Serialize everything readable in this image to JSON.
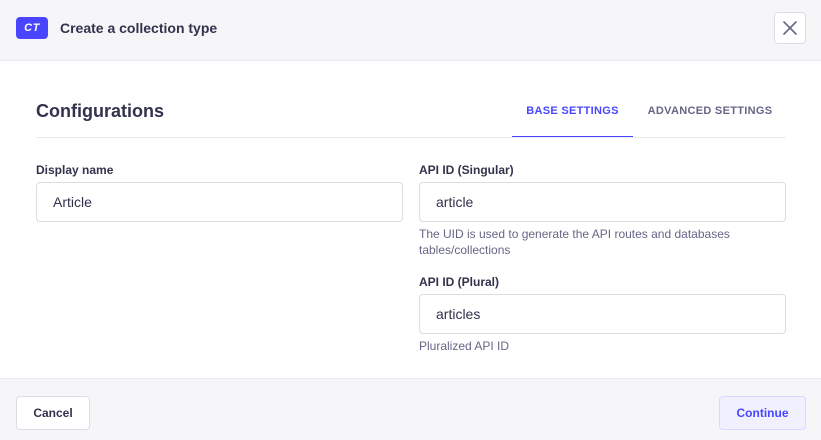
{
  "header": {
    "badge": "CT",
    "title": "Create a collection type",
    "close_icon": "close-icon"
  },
  "section": {
    "title": "Configurations"
  },
  "tabs": [
    {
      "label": "BASE SETTINGS",
      "active": true
    },
    {
      "label": "ADVANCED SETTINGS",
      "active": false
    }
  ],
  "form": {
    "display_name": {
      "label": "Display name",
      "value": "Article"
    },
    "api_singular": {
      "label": "API ID (Singular)",
      "value": "article",
      "hint": "The UID is used to generate the API routes and databases tables/collections"
    },
    "api_plural": {
      "label": "API ID (Plural)",
      "value": "articles",
      "hint": "Pluralized API ID"
    }
  },
  "footer": {
    "cancel_label": "Cancel",
    "continue_label": "Continue"
  },
  "colors": {
    "accent": "#4945ff",
    "header_bg": "#f6f6f9",
    "text": "#32324d",
    "muted": "#666687"
  }
}
